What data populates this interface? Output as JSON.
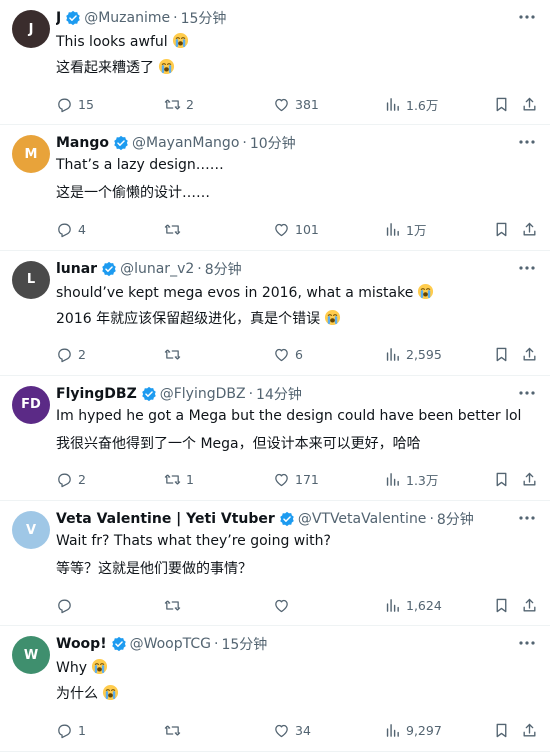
{
  "colors": {
    "verified": "#1d9bf0",
    "muted": "#536471",
    "text": "#0f1419"
  },
  "posts": [
    {
      "name": "J",
      "handle": "@Muzanime",
      "time": "15分钟",
      "avatar": {
        "initials": "J",
        "bg": "#3a2d2d"
      },
      "line1": "This looks awful",
      "line1_emoji": true,
      "line2": "这看起来糟透了",
      "line2_emoji": true,
      "replies": "15",
      "retweets": "2",
      "likes": "381",
      "views": "1.6万"
    },
    {
      "name": "Mango",
      "handle": "@MayanMango",
      "time": "10分钟",
      "avatar": {
        "initials": "M",
        "bg": "#e8a33a"
      },
      "line1": "That’s a lazy design……",
      "line1_emoji": false,
      "line2": "这是一个偷懒的设计……",
      "line2_emoji": false,
      "replies": "4",
      "retweets": "",
      "likes": "101",
      "views": "1万"
    },
    {
      "name": "lunar",
      "handle": "@lunar_v2",
      "time": "8分钟",
      "avatar": {
        "initials": "L",
        "bg": "#4a4a4a"
      },
      "line1": "should’ve kept mega evos in 2016, what a mistake",
      "line1_emoji": true,
      "line2": "2016 年就应该保留超级进化，真是个错误",
      "line2_emoji": true,
      "replies": "2",
      "retweets": "",
      "likes": "6",
      "views": "2,595"
    },
    {
      "name": "FlyingDBZ",
      "handle": "@FlyingDBZ",
      "time": "14分钟",
      "avatar": {
        "initials": "FD",
        "bg": "#5b2a86"
      },
      "line1": "Im hyped he got a Mega but the design could have been better lol",
      "line1_emoji": false,
      "line2": "我很兴奋他得到了一个 Mega，但设计本来可以更好，哈哈",
      "line2_emoji": false,
      "replies": "2",
      "retweets": "1",
      "likes": "171",
      "views": "1.3万"
    },
    {
      "name": "Veta Valentine | Yeti Vtuber",
      "handle": "@VTVetaValentine",
      "time": "8分钟",
      "avatar": {
        "initials": "V",
        "bg": "#9fc7e6"
      },
      "line1": "Wait fr? Thats what they’re going with?",
      "line1_emoji": false,
      "line2": "等等？这就是他们要做的事情？",
      "line2_emoji": false,
      "replies": "",
      "retweets": "",
      "likes": "",
      "views": "1,624"
    },
    {
      "name": "Woop!",
      "handle": "@WoopTCG",
      "time": "15分钟",
      "avatar": {
        "initials": "W",
        "bg": "#3f8f6e"
      },
      "line1": "Why",
      "line1_emoji": true,
      "line2": "为什么",
      "line2_emoji": true,
      "replies": "1",
      "retweets": "",
      "likes": "34",
      "views": "9,297"
    }
  ]
}
